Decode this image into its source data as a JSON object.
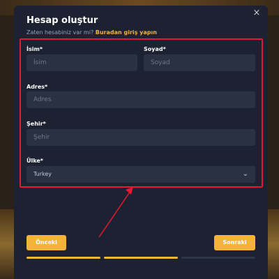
{
  "modal": {
    "title": "Hesap oluştur",
    "close_label": "×",
    "subtitle_text": "Zaten hesabiniz var mi?",
    "login_link": "Buradan giriş yapın"
  },
  "form": {
    "first_name": {
      "label": "İsim*",
      "placeholder": "İsim"
    },
    "last_name": {
      "label": "Soyad*",
      "placeholder": "Soyad"
    },
    "address": {
      "label": "Adres*",
      "placeholder": "Adres"
    },
    "city": {
      "label": "Şehir*",
      "placeholder": "Şehir"
    },
    "country": {
      "label": "Ülke*",
      "value": "Turkey"
    }
  },
  "buttons": {
    "prev": "Önceki",
    "next": "Sonraki"
  },
  "progress": {
    "steps_total": 3,
    "steps_completed": 2
  },
  "colors": {
    "accent": "#f5b33a",
    "highlight": "#e5192f"
  },
  "icons": {
    "close": "close-icon",
    "dropdown": "chevron-down-icon"
  }
}
